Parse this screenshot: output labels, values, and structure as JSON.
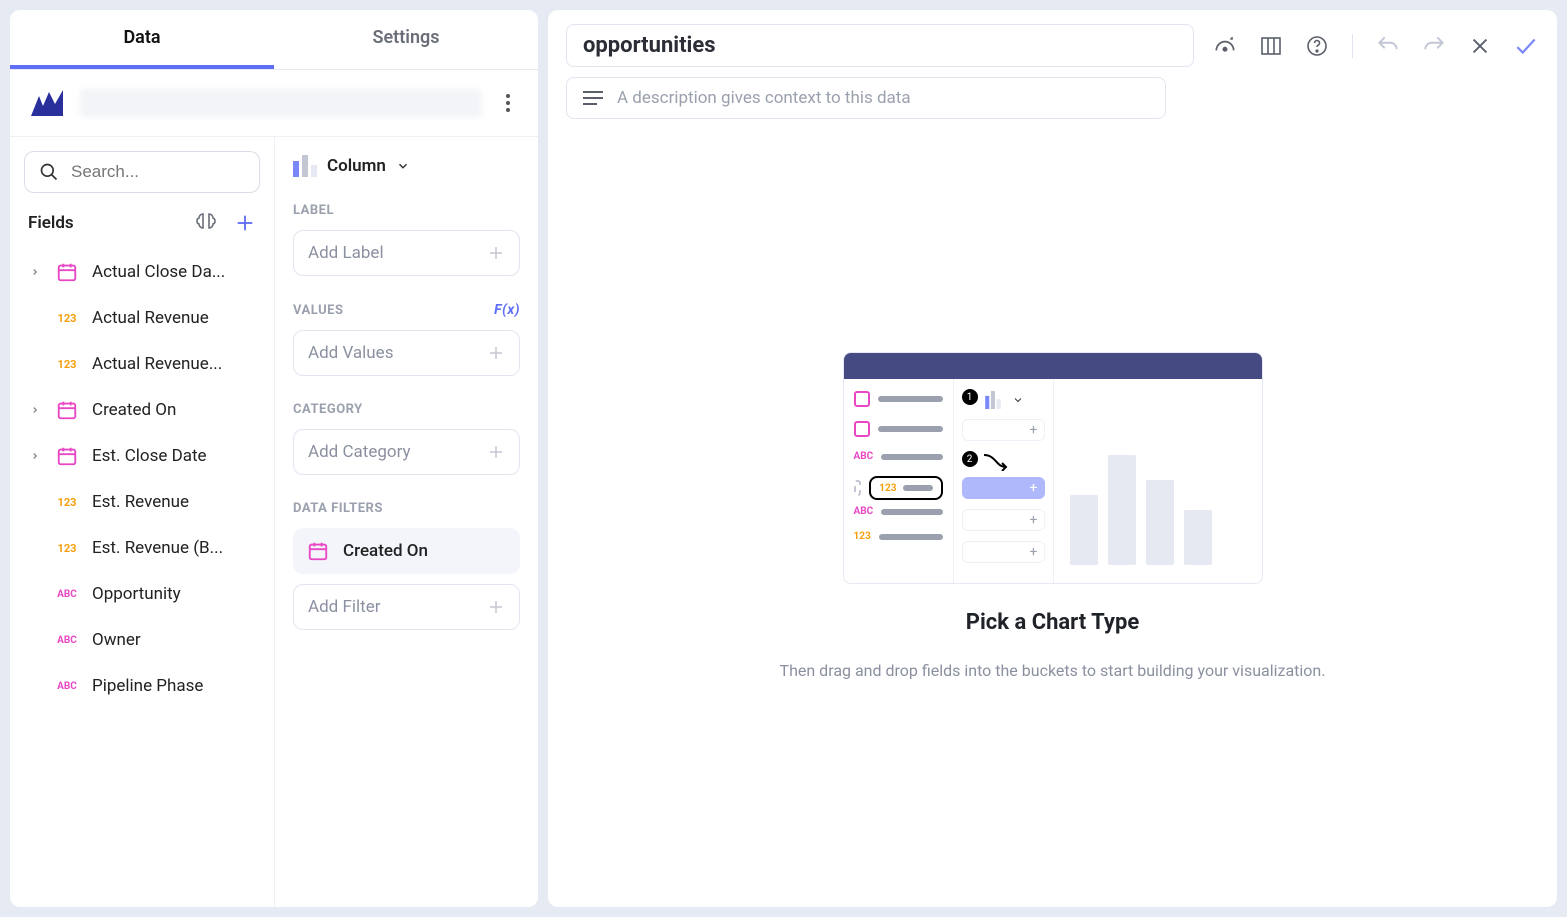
{
  "tabs": {
    "data": "Data",
    "settings": "Settings"
  },
  "search": {
    "placeholder": "Search..."
  },
  "fields_header": "Fields",
  "fields": [
    {
      "type": "date",
      "label": "Actual Close Da...",
      "expandable": true
    },
    {
      "type": "num",
      "label": "Actual Revenue",
      "expandable": false
    },
    {
      "type": "num",
      "label": "Actual Revenue...",
      "expandable": false
    },
    {
      "type": "date",
      "label": "Created On",
      "expandable": true
    },
    {
      "type": "date",
      "label": "Est. Close Date",
      "expandable": true
    },
    {
      "type": "num",
      "label": "Est. Revenue",
      "expandable": false
    },
    {
      "type": "num",
      "label": "Est. Revenue (B...",
      "expandable": false
    },
    {
      "type": "abc",
      "label": "Opportunity",
      "expandable": false
    },
    {
      "type": "abc",
      "label": "Owner",
      "expandable": false
    },
    {
      "type": "abc",
      "label": "Pipeline Phase",
      "expandable": false
    }
  ],
  "type_tokens": {
    "num": "123",
    "abc": "ABC"
  },
  "chart_type": "Column",
  "buckets": {
    "label": {
      "title": "LABEL",
      "placeholder": "Add Label"
    },
    "values": {
      "title": "VALUES",
      "placeholder": "Add Values",
      "fx": "F(x)"
    },
    "category": {
      "title": "CATEGORY",
      "placeholder": "Add Category"
    },
    "filters": {
      "title": "DATA FILTERS",
      "chip": "Created On",
      "placeholder": "Add Filter"
    }
  },
  "title": "opportunities",
  "description_placeholder": "A description gives context to this data",
  "empty": {
    "title": "Pick a Chart Type",
    "subtitle": "Then drag and drop fields into the buckets to start building your visualization."
  },
  "illus_tokens": {
    "abc": "ABC",
    "num": "123"
  }
}
